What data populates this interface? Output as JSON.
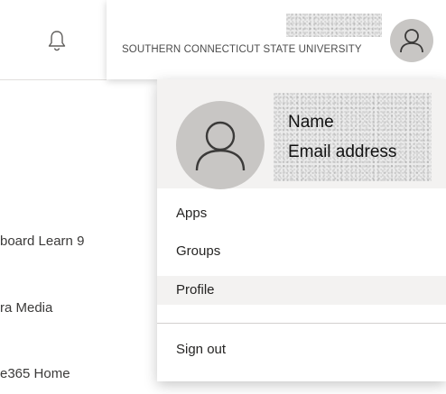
{
  "topbar": {
    "organization": "SOUTHERN CONNECTICUT STATE UNIVERSITY",
    "notification_icon": "bell-icon",
    "avatar_icon": "person-icon"
  },
  "sidebar": {
    "items": [
      {
        "label": "board Learn 9"
      },
      {
        "label": "ra Media"
      },
      {
        "label": "e365 Home"
      }
    ]
  },
  "account_menu": {
    "name": "Name",
    "email": "Email address",
    "items": [
      {
        "label": "Apps"
      },
      {
        "label": "Groups"
      },
      {
        "label": "Profile"
      },
      {
        "label": "Sign out"
      }
    ],
    "highlighted_item": "Profile"
  }
}
